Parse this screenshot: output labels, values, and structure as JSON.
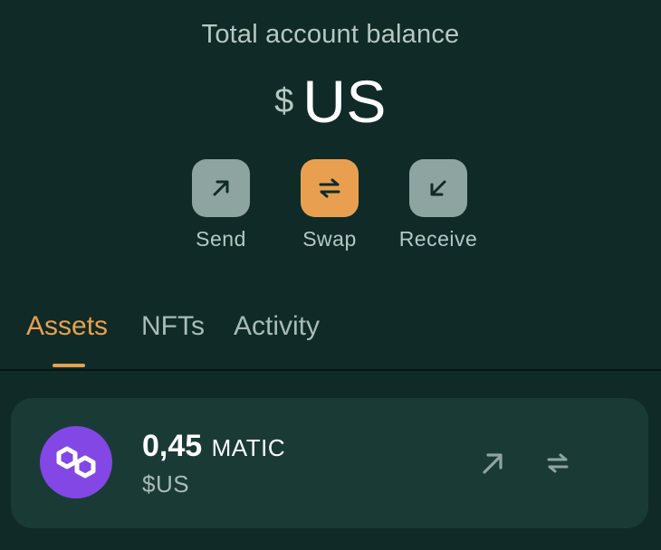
{
  "balance": {
    "label": "Total account balance",
    "currency_symbol": "$",
    "value": "US"
  },
  "actions": [
    {
      "label": "Send",
      "icon": "arrow-up-right-icon",
      "color": "#8ea4a0"
    },
    {
      "label": "Swap",
      "icon": "swap-arrows-icon",
      "color": "#e8a050"
    },
    {
      "label": "Receive",
      "icon": "arrow-down-left-icon",
      "color": "#8ea4a0"
    }
  ],
  "tabs": [
    {
      "label": "Assets",
      "active": true
    },
    {
      "label": "NFTs",
      "active": false
    },
    {
      "label": "Activity",
      "active": false
    }
  ],
  "assets": [
    {
      "amount": "0,45",
      "symbol": "MATIC",
      "fiat": "$US",
      "icon": "polygon-logo-icon",
      "icon_color": "#8247e5",
      "actions": [
        "send-icon",
        "swap-icon"
      ]
    }
  ],
  "colors": {
    "background": "#0f2a27",
    "card": "#1a3a36",
    "accent": "#e8a050",
    "muted_text": "#b7c7c2"
  }
}
